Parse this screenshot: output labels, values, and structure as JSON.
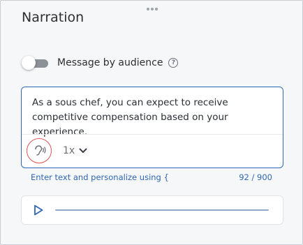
{
  "panel": {
    "title": "Narration"
  },
  "audience_toggle": {
    "label": "Message by audience",
    "enabled": false,
    "help_icon": "question-circle-icon"
  },
  "editor": {
    "text": "As a sous chef, you can expect to receive competitive compensation based on your experience.",
    "voice_icon": "listening-ear-icon",
    "speed_value": "1x",
    "speed_icon": "chevron-down-icon"
  },
  "hint": {
    "text": "Enter text and personalize using {",
    "char_count": "92 / 900"
  },
  "player": {
    "play_icon": "play-icon",
    "progress": 0
  },
  "colors": {
    "accent": "#2f66b3",
    "voice_ring": "#e05555",
    "panel_bg": "#f6f7f9"
  }
}
